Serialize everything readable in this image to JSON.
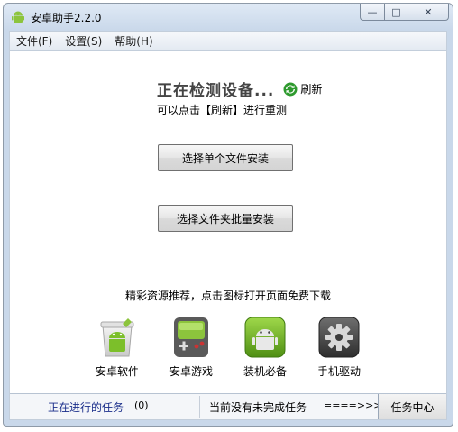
{
  "window": {
    "title": "安卓助手2.2.0",
    "controls": {
      "minimize": "—",
      "maximize": "□",
      "close": "✕"
    }
  },
  "menu": [
    {
      "label": "文件(F)"
    },
    {
      "label": "设置(S)"
    },
    {
      "label": "帮助(H)"
    }
  ],
  "status": {
    "detecting": "正在检测设备...",
    "refresh_label": "刷新",
    "hint": "可以点击【刷新】进行重测"
  },
  "buttons": {
    "single": "选择单个文件安装",
    "folder": "选择文件夹批量安装"
  },
  "recommend": {
    "title": "精彩资源推荐，点击图标打开页面免费下载",
    "items": [
      {
        "label": "安卓软件",
        "icon": "android-software-icon"
      },
      {
        "label": "安卓游戏",
        "icon": "android-game-icon"
      },
      {
        "label": "装机必备",
        "icon": "essentials-icon"
      },
      {
        "label": "手机驱动",
        "icon": "driver-gear-icon"
      }
    ]
  },
  "statusbar": {
    "tasks_label": "正在进行的任务",
    "tasks_count": "(0)",
    "message": "当前没有未完成任务",
    "arrow": "====>>>",
    "task_center": "任务中心"
  },
  "colors": {
    "accent_green": "#7cbf2a",
    "tasks_link": "#1a2e8a"
  }
}
